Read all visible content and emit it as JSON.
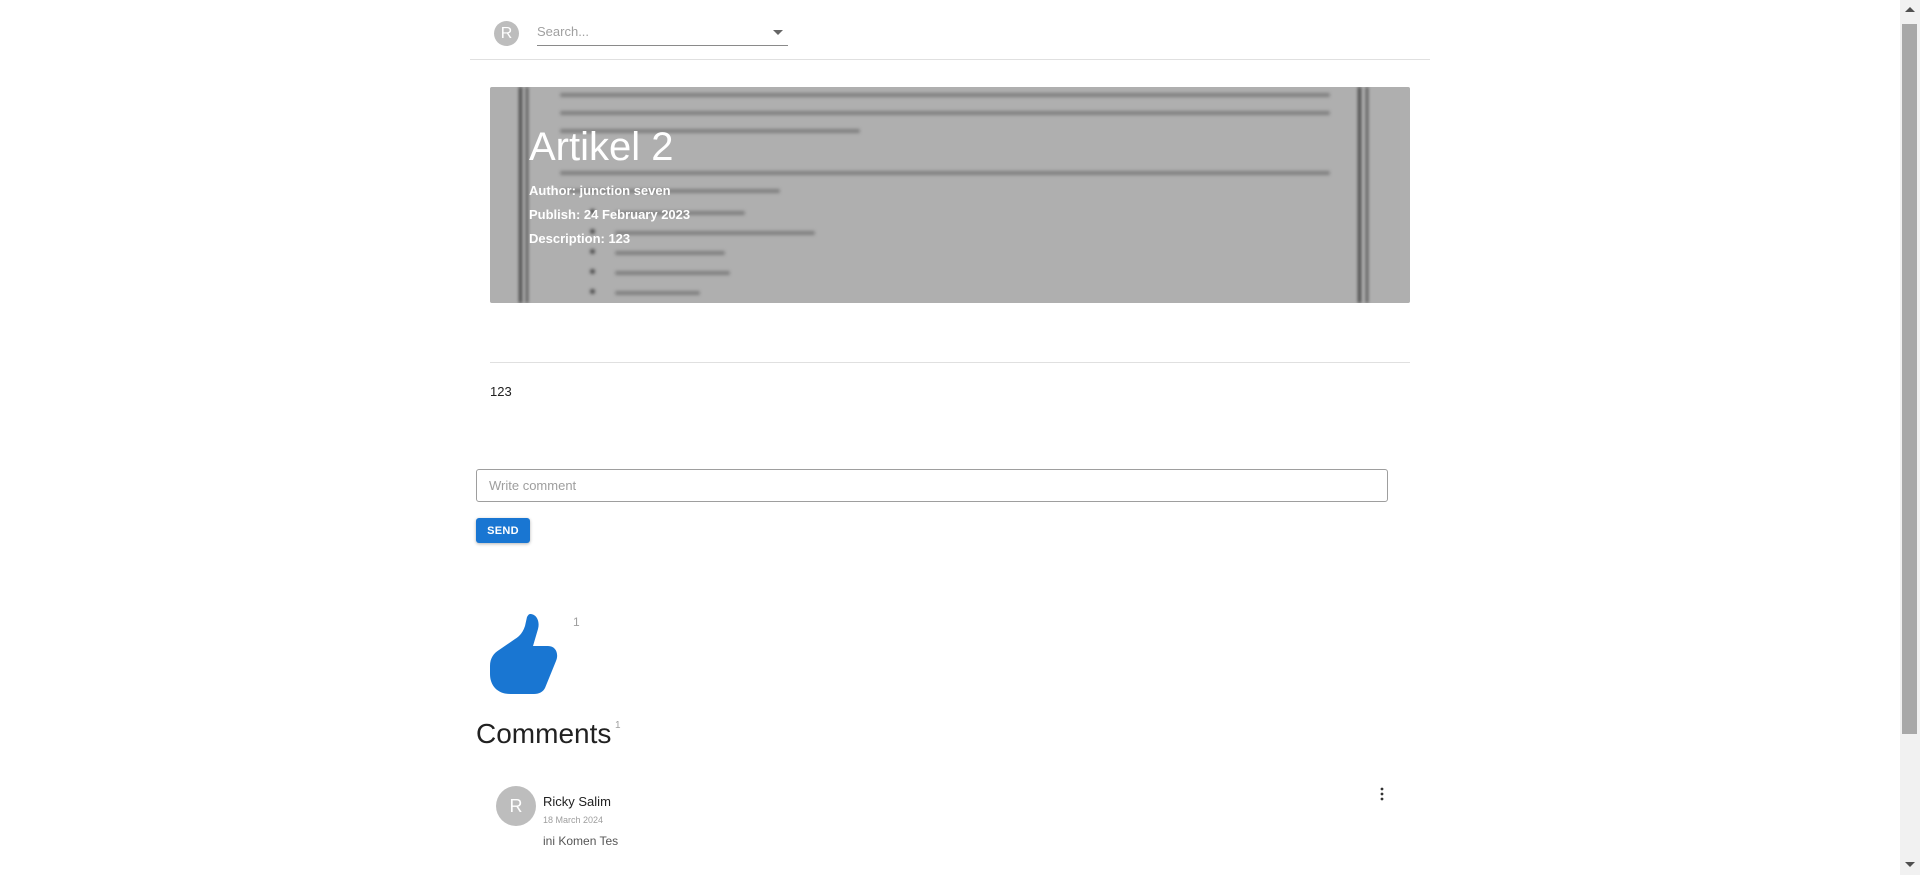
{
  "header": {
    "avatar_initial": "R",
    "search": {
      "placeholder": "Search..."
    }
  },
  "article": {
    "title": "Artikel 2",
    "author": "Author: junction seven",
    "publish": "Publish: 24 February 2023",
    "description": "Description: 123",
    "body": "123"
  },
  "comment_form": {
    "placeholder": "Write comment",
    "send_label": "SEND"
  },
  "likes": {
    "count": "1",
    "icon": "thumb-up-icon",
    "color": "#1976d2"
  },
  "comments": {
    "heading": "Comments",
    "count": "1",
    "items": [
      {
        "avatar_initial": "R",
        "author": "Ricky Salim",
        "date": "18 March 2024",
        "text": "ini Komen Tes"
      }
    ]
  },
  "colors": {
    "accent": "#1976d2",
    "avatar": "#bdbdbd"
  }
}
